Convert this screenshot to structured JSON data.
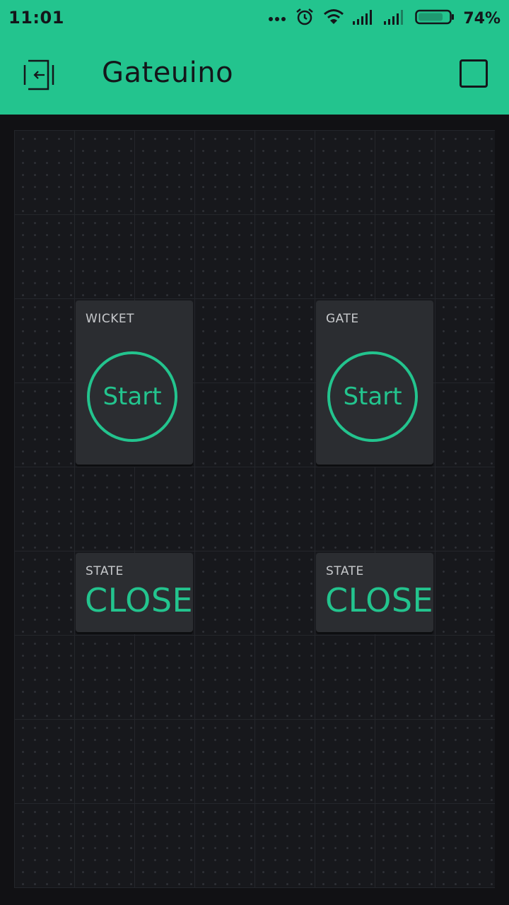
{
  "status_bar": {
    "time": "11:01",
    "battery_percent": "74%",
    "icons": [
      "more-dots-icon",
      "alarm-icon",
      "wifi-icon",
      "signal-icon",
      "signal-icon",
      "battery-icon"
    ]
  },
  "app_bar": {
    "title": "Gateuino",
    "back_icon": "exit-icon",
    "stop_icon": "stop-icon",
    "accent_color": "#23c48e"
  },
  "widgets": {
    "wicket_button": {
      "label": "WICKET",
      "button_text": "Start"
    },
    "gate_button": {
      "label": "GATE",
      "button_text": "Start"
    },
    "wicket_state": {
      "label": "STATE",
      "value": "CLOSE"
    },
    "gate_state": {
      "label": "STATE",
      "value": "CLOSE"
    }
  }
}
